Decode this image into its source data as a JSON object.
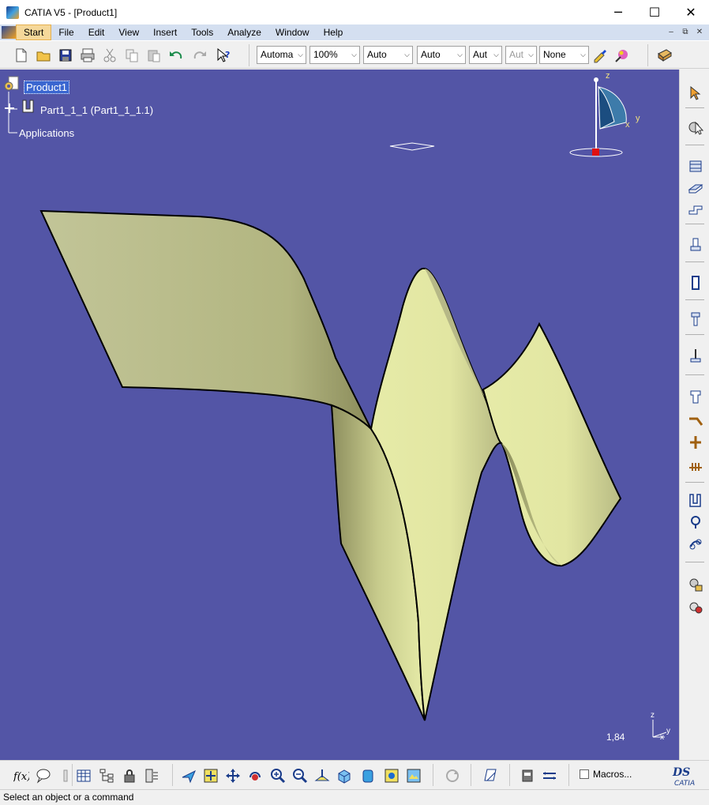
{
  "window": {
    "title": "CATIA V5 - [Product1]",
    "minimize_glyph": "─",
    "maximize_glyph": "☐",
    "close_glyph": "✕"
  },
  "menu": {
    "items": [
      "Start",
      "File",
      "Edit",
      "View",
      "Insert",
      "Tools",
      "Analyze",
      "Window",
      "Help"
    ],
    "mdi_minimize": "–",
    "mdi_restore": "⧉",
    "mdi_close": "✕"
  },
  "toolbar": {
    "combos": {
      "line_type": "Automa",
      "zoom": "100%",
      "thickness": "Auto",
      "color": "Auto",
      "layer": "Aut",
      "layer2": "Aut",
      "pattern": "None"
    },
    "icons": [
      "new-icon",
      "open-icon",
      "save-icon",
      "print-icon",
      "cut-icon",
      "copy-icon",
      "paste-icon",
      "undo-icon",
      "redo-icon",
      "whats-this-icon",
      "format-painter-icon",
      "color-palette-icon",
      "camera-icon"
    ]
  },
  "tree": {
    "root": "Product1",
    "part": "Part1_1_1 (Part1_1_1.1)",
    "applications": "Applications"
  },
  "compass": {
    "z": "z",
    "x": "x",
    "y": "y"
  },
  "viewport": {
    "background": "#5355a6",
    "surface_color": "#e6eba8",
    "zoom_readout": "1,84",
    "axis_z": "z",
    "axis_x": "x",
    "axis_y": "y"
  },
  "right_toolbar": {
    "icons": [
      "select-arrow-icon",
      "product-component-icon",
      "pad-icon",
      "pocket-icon",
      "shaft-icon",
      "groove-icon",
      "rib-icon",
      "hole-icon",
      "slot-icon",
      "stiffener-icon",
      "loft-icon",
      "fillet-icon",
      "chamfer-icon",
      "draft-icon",
      "shell-icon",
      "thickness-icon",
      "thread-icon",
      "sketch-icon",
      "plane-icon",
      "point-icon",
      "line-icon",
      "axis-system-icon",
      "analysis-icon"
    ]
  },
  "bottom_toolbar": {
    "macros_label": "Macros...",
    "icons": [
      "formula-icon",
      "comment-icon",
      "measure-icon",
      "table-icon",
      "tree-icon",
      "lock-icon",
      "catalog-icon",
      "fly-mode-icon",
      "fit-all-icon",
      "pan-icon",
      "rotate-icon",
      "zoom-in-icon",
      "zoom-out-icon",
      "normal-view-icon",
      "iso-view-icon",
      "render-style-icon",
      "hide-show-icon",
      "swap-visible-icon",
      "update-icon",
      "publish-icon",
      "macro-record-icon",
      "measure-between-icon",
      "catia-logo"
    ]
  },
  "status": {
    "message": "Select an object or a command"
  }
}
